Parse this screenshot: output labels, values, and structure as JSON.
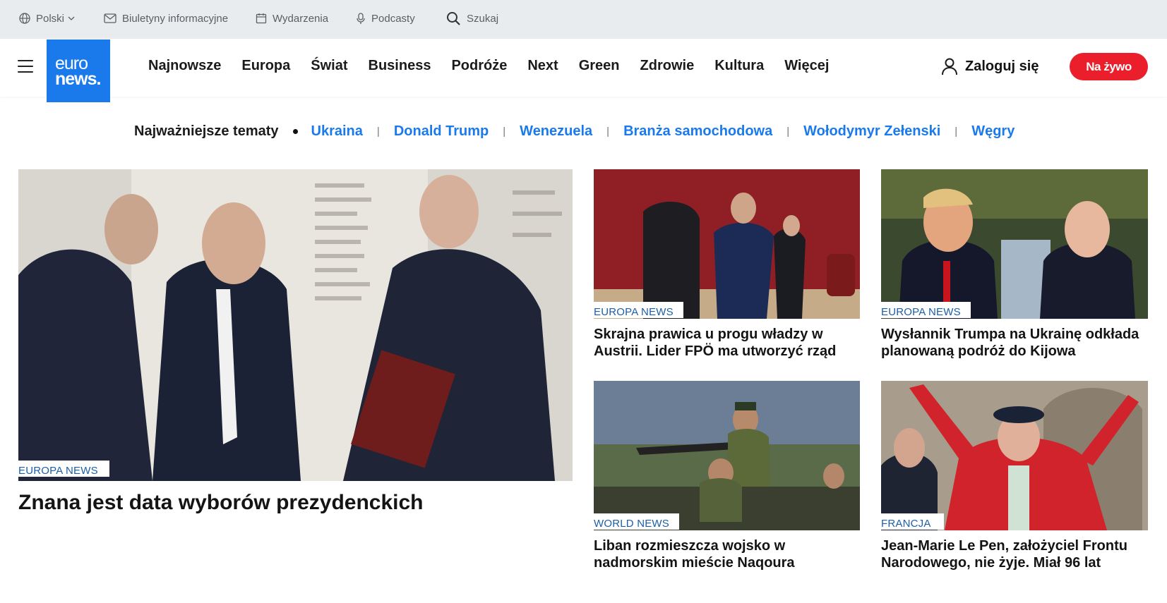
{
  "utility": {
    "language": "Polski",
    "newsletters": "Biuletyny informacyjne",
    "events": "Wydarzenia",
    "podcasts": "Podcasty",
    "search": "Szukaj"
  },
  "header": {
    "logo_line1": "euro",
    "logo_line2": "news.",
    "nav": [
      "Najnowsze",
      "Europa",
      "Świat",
      "Business",
      "Podróże",
      "Next",
      "Green",
      "Zdrowie",
      "Kultura",
      "Więcej"
    ],
    "login": "Zaloguj się",
    "live": "Na żywo"
  },
  "topics": {
    "heading": "Najważniejsze tematy",
    "items": [
      "Ukraina",
      "Donald Trump",
      "Wenezuela",
      "Branża samochodowa",
      "Wołodymyr Zełenski",
      "Węgry"
    ]
  },
  "articles": [
    {
      "tag": "EUROPA NEWS",
      "title": "Znana jest data wyborów prezydenckich"
    },
    {
      "tag": "EUROPA NEWS",
      "title": "Skrajna prawica u progu władzy w Austrii. Lider FPÖ ma utworzyć rząd"
    },
    {
      "tag": "EUROPA NEWS",
      "title": "Wysłannik Trumpa na Ukrainę odkłada planowaną podróż do Kijowa"
    },
    {
      "tag": "WORLD NEWS",
      "title": "Liban rozmieszcza wojsko w nadmorskim mieście Naqoura"
    },
    {
      "tag": "FRANCJA",
      "title": "Jean-Marie Le Pen, założyciel Frontu Narodowego, nie żyje. Miał 96 lat"
    }
  ],
  "colors": {
    "brand": "#1a7aec",
    "live": "#ea1f2b",
    "tag": "#1c5ea8",
    "utility_bg": "#e9ecee"
  }
}
